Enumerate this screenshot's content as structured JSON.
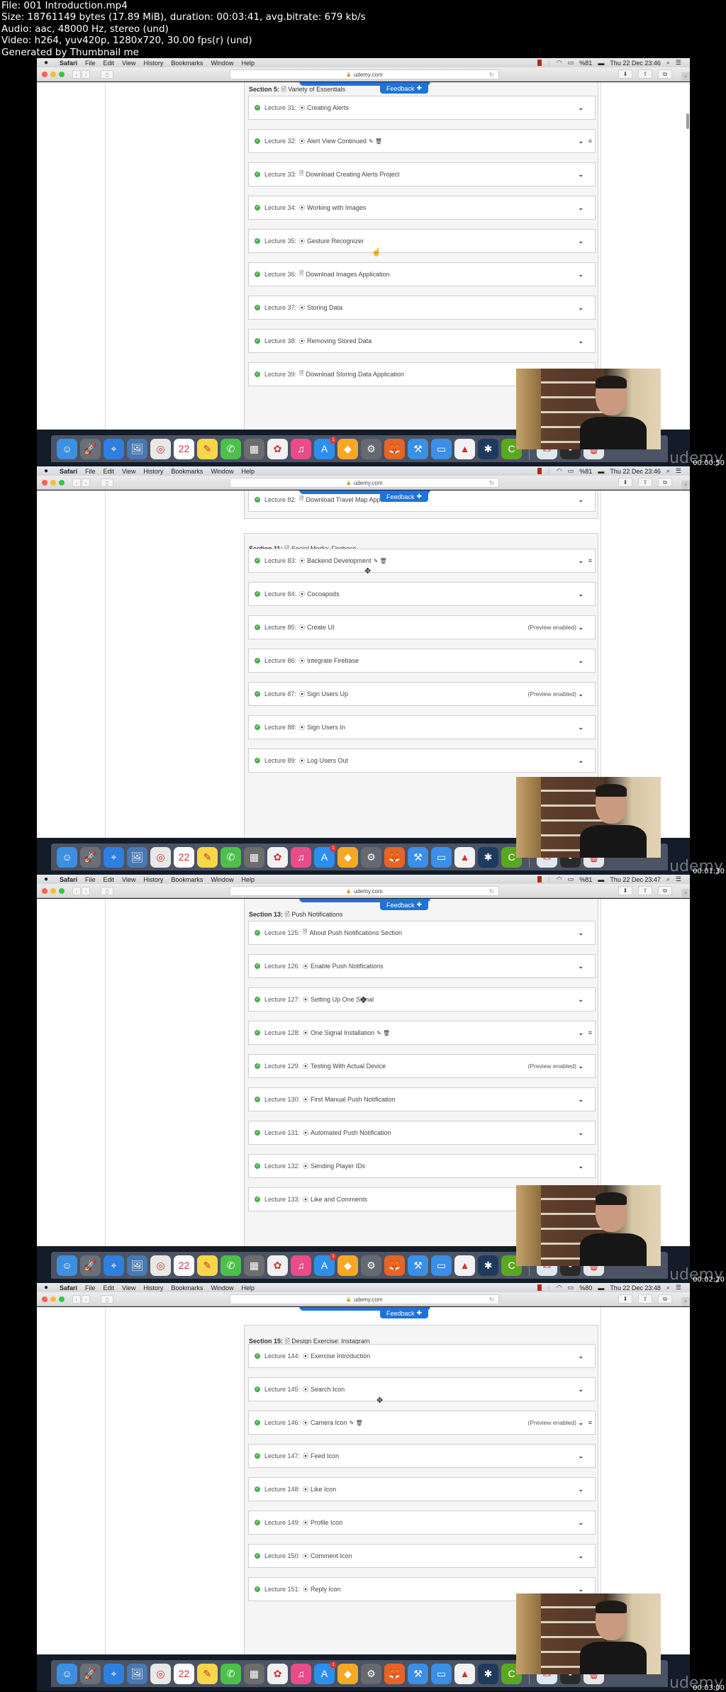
{
  "file_info": {
    "line1": "File: 001 Introduction.mp4",
    "line2": "Size: 18761149 bytes (17.89 MiB), duration: 00:03:41, avg.bitrate: 679 kb/s",
    "line3": "Audio: aac, 48000 Hz, stereo (und)",
    "line4": "Video: h264, yuv420p, 1280x720, 30.00 fps(r) (und)",
    "line5": "Generated by Thumbnail me"
  },
  "menubar": {
    "app": "Safari",
    "items": [
      "File",
      "Edit",
      "View",
      "History",
      "Bookmarks",
      "Window",
      "Help"
    ]
  },
  "browser": {
    "url": "udemy.com",
    "feedback_label": "Feedback"
  },
  "dock": {
    "apps": [
      "Finder",
      "Launchpad",
      "Safari",
      "Preview",
      "Chrome",
      "Calendar",
      "Notes",
      "FaceTime",
      "Calculator",
      "Photos",
      "iTunes",
      "App Store",
      "Sketch",
      "System Preferences",
      "Firefox",
      "Xcode",
      "Simulator",
      "VLC",
      "SourceTree",
      "Camtasia",
      "Certificate",
      "Camtasia Recorder",
      "Trash"
    ],
    "calendar_day": "22",
    "appstore_badge": "1"
  },
  "watermark": "udemy",
  "frames": [
    {
      "timestamp": "00:00:50",
      "clock": "Thu 22 Dec 23:46",
      "battery": "%81",
      "sections": [
        {
          "label": "Section 5:",
          "title": "Variety of Essentials"
        }
      ],
      "lectures": [
        {
          "num": "Lecture 31:",
          "type": "video",
          "title": "Creating Alerts",
          "preview": "",
          "editing": false
        },
        {
          "num": "Lecture 32:",
          "type": "video",
          "title": "Alert View Continued",
          "preview": "",
          "editing": true
        },
        {
          "num": "Lecture 33:",
          "type": "file",
          "title": "Download Creating Alerts Project",
          "preview": "",
          "editing": false
        },
        {
          "num": "Lecture 34:",
          "type": "video",
          "title": "Working with Images",
          "preview": "",
          "editing": false
        },
        {
          "num": "Lecture 35:",
          "type": "video",
          "title": "Gesture Recognizer",
          "preview": "",
          "editing": false
        },
        {
          "num": "Lecture 36:",
          "type": "file",
          "title": "Download Images Application",
          "preview": "",
          "editing": false
        },
        {
          "num": "Lecture 37:",
          "type": "video",
          "title": "Storing Data",
          "preview": "",
          "editing": false
        },
        {
          "num": "Lecture 38:",
          "type": "video",
          "title": "Removing Stored Data",
          "preview": "",
          "editing": false
        },
        {
          "num": "Lecture 39:",
          "type": "file",
          "title": "Download Storing Data Application",
          "preview": "",
          "editing": false
        }
      ]
    },
    {
      "timestamp": "00:01:30",
      "clock": "Thu 22 Dec 23:46",
      "battery": "%81",
      "sections": [
        {
          "label": "Section 11:",
          "title": "Social Media: Firebase"
        }
      ],
      "lectures": [
        {
          "num": "Lecture 82:",
          "type": "file",
          "title": "Download Travel Map Application",
          "preview": "",
          "editing": false
        },
        {
          "num": "Lecture 83:",
          "type": "video",
          "title": "Backend Development",
          "preview": "",
          "editing": true
        },
        {
          "num": "Lecture 84:",
          "type": "video",
          "title": "Cocoapods",
          "preview": "",
          "editing": false
        },
        {
          "num": "Lecture 85:",
          "type": "video",
          "title": "Create UI",
          "preview": "(Preview enabled)",
          "editing": false
        },
        {
          "num": "Lecture 86:",
          "type": "video",
          "title": "Integrate Firebase",
          "preview": "",
          "editing": false
        },
        {
          "num": "Lecture 87:",
          "type": "video",
          "title": "Sign Users Up",
          "preview": "(Preview enabled)",
          "editing": false
        },
        {
          "num": "Lecture 88:",
          "type": "video",
          "title": "Sign Users In",
          "preview": "",
          "editing": false
        },
        {
          "num": "Lecture 89:",
          "type": "video",
          "title": "Log Users Out",
          "preview": "",
          "editing": false
        }
      ]
    },
    {
      "timestamp": "00:02:20",
      "clock": "Thu 22 Dec 23:47",
      "battery": "%81",
      "sections": [
        {
          "label": "Section 13:",
          "title": "Push Notifications"
        }
      ],
      "lectures": [
        {
          "num": "Lecture 125:",
          "type": "file",
          "title": "About Push Notifications Section",
          "preview": "",
          "editing": false
        },
        {
          "num": "Lecture 126:",
          "type": "video",
          "title": "Enable Push Notifications",
          "preview": "",
          "editing": false
        },
        {
          "num": "Lecture 127:",
          "type": "video",
          "title": "Setting Up One Signal",
          "preview": "",
          "editing": false
        },
        {
          "num": "Lecture 128:",
          "type": "video",
          "title": "One Signal Installation",
          "preview": "",
          "editing": true
        },
        {
          "num": "Lecture 129:",
          "type": "video",
          "title": "Testing With Actual Device",
          "preview": "(Preview enabled)",
          "editing": false
        },
        {
          "num": "Lecture 130:",
          "type": "video",
          "title": "First Manual Push Notification",
          "preview": "",
          "editing": false
        },
        {
          "num": "Lecture 131:",
          "type": "video",
          "title": "Automated Push Notification",
          "preview": "",
          "editing": false
        },
        {
          "num": "Lecture 132:",
          "type": "video",
          "title": "Sending Player IDs",
          "preview": "",
          "editing": false
        },
        {
          "num": "Lecture 133:",
          "type": "video",
          "title": "Like and Comments",
          "preview": "",
          "editing": false
        }
      ]
    },
    {
      "timestamp": "00:03:00",
      "clock": "Thu 22 Dec 23:48",
      "battery": "%80",
      "sections": [
        {
          "label": "Section 15:",
          "title": "Design Exercise: Instagram"
        }
      ],
      "lectures": [
        {
          "num": "Lecture 144:",
          "type": "video",
          "title": "Exercise Introduction",
          "preview": "",
          "editing": false
        },
        {
          "num": "Lecture 145:",
          "type": "video",
          "title": "Search Icon",
          "preview": "",
          "editing": false
        },
        {
          "num": "Lecture 146:",
          "type": "video",
          "title": "Camera Icon",
          "preview": "(Preview enabled)",
          "editing": true
        },
        {
          "num": "Lecture 147:",
          "type": "video",
          "title": "Feed Icon",
          "preview": "",
          "editing": false
        },
        {
          "num": "Lecture 148:",
          "type": "video",
          "title": "Like Icon",
          "preview": "",
          "editing": false
        },
        {
          "num": "Lecture 149:",
          "type": "video",
          "title": "Profile Icon",
          "preview": "",
          "editing": false
        },
        {
          "num": "Lecture 150:",
          "type": "video",
          "title": "Comment Icon",
          "preview": "",
          "editing": false
        },
        {
          "num": "Lecture 151:",
          "type": "video",
          "title": "Reply Icon",
          "preview": "",
          "editing": false
        }
      ]
    }
  ]
}
